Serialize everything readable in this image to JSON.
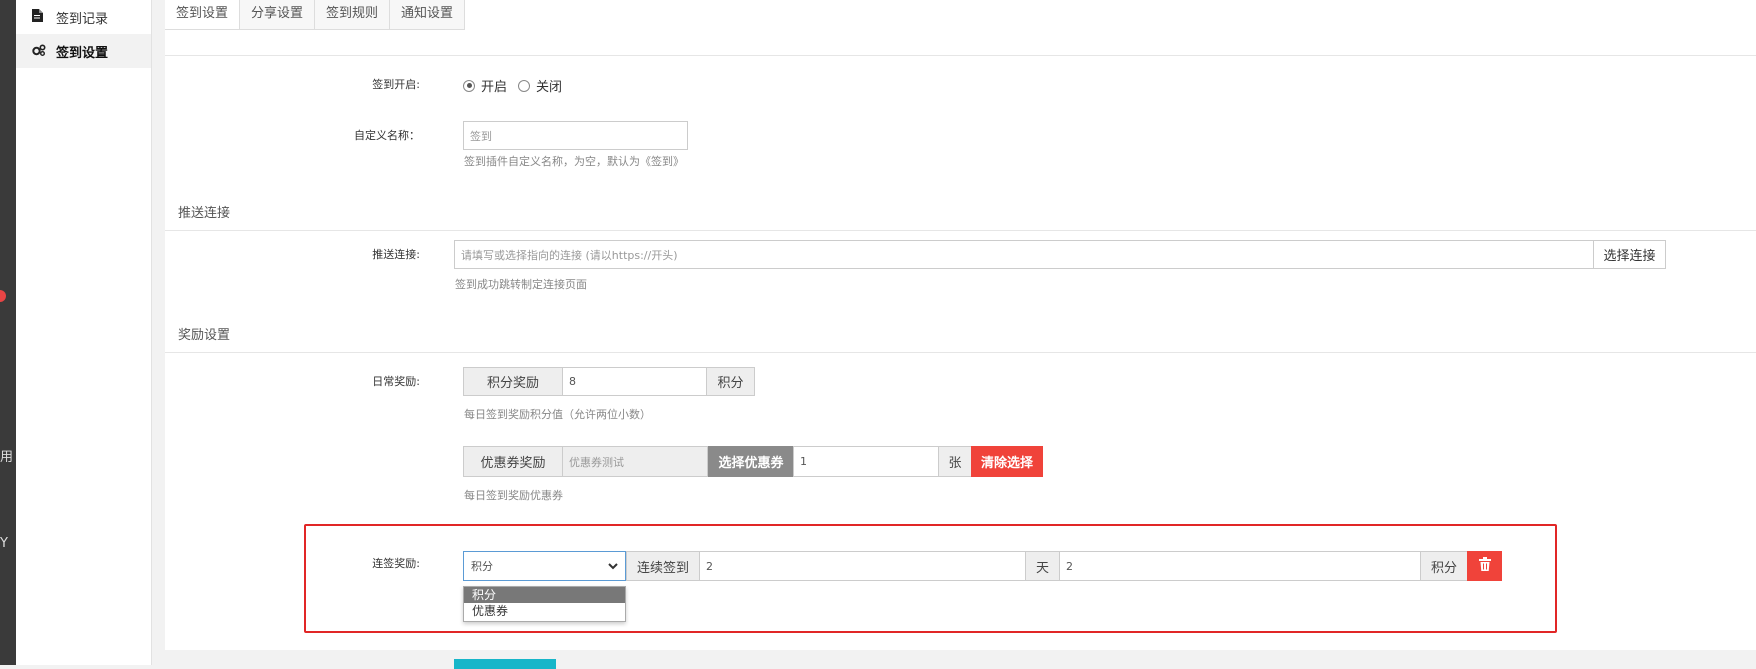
{
  "left_rail": {
    "items": [
      "用",
      "Y"
    ]
  },
  "sidebar": {
    "items": [
      {
        "label": "签到记录",
        "icon": "file-icon"
      },
      {
        "label": "签到设置",
        "icon": "gears-icon",
        "active": true
      }
    ]
  },
  "tabs": [
    {
      "label": "签到设置",
      "active": true
    },
    {
      "label": "分享设置"
    },
    {
      "label": "签到规则"
    },
    {
      "label": "通知设置"
    }
  ],
  "form": {
    "enable": {
      "label": "签到开启:",
      "options": [
        "开启",
        "关闭"
      ],
      "selected": "开启"
    },
    "custom_name": {
      "label": "自定义名称：",
      "placeholder": "签到",
      "help": "签到插件自定义名称，为空，默认为《签到》"
    },
    "push_section": "推送连接",
    "push_link": {
      "label": "推送连接:",
      "placeholder": "请填写或选择指向的连接 (请以https://开头)",
      "button": "选择连接",
      "help": "签到成功跳转制定连接页面"
    },
    "reward_section": "奖励设置",
    "daily_reward": {
      "label": "日常奖励:",
      "points_addon": "积分奖励",
      "points_value": "8",
      "points_unit": "积分",
      "points_help": "每日签到奖励积分值（允许两位小数）",
      "coupon_addon": "优惠券奖励",
      "coupon_name": "优惠券测试",
      "coupon_button": "选择优惠券",
      "coupon_qty": "1",
      "coupon_unit": "张",
      "clear_button": "清除选择",
      "coupon_help": "每日签到奖励优惠券"
    },
    "streak_reward": {
      "label": "连签奖励:",
      "select_value": "积分",
      "select_options": [
        {
          "label": "积分",
          "selected": true
        },
        {
          "label": "优惠券"
        }
      ],
      "streak_addon": "连续签到",
      "days_value": "2",
      "days_unit": "天",
      "points_value": "2",
      "points_unit": "积分"
    }
  },
  "colors": {
    "accent_red": "#f0433a",
    "highlight_border": "#e12626",
    "submit_teal": "#17b6c9",
    "focus_blue": "#5b9bd5"
  }
}
